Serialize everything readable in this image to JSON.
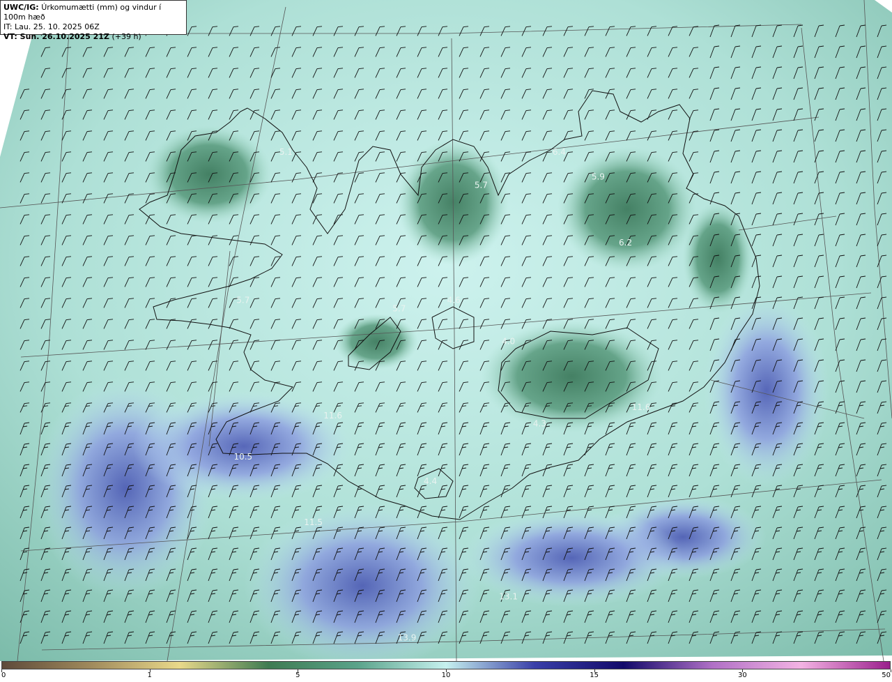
{
  "header": {
    "product": "UWC/IG:",
    "title": "Úrkomumætti (mm) og vindur í 100m hæð",
    "init_time": "IT: Lau. 25. 10. 2025 06Z",
    "valid_prefix": "VT: Sun. 26.10.2025 21Z",
    "valid_offset": "(+39 h)"
  },
  "map_labels": [
    {
      "text": "5.1",
      "lon": -22.9,
      "lat": 65.75
    },
    {
      "text": "5.7",
      "lon": -17.9,
      "lat": 65.55
    },
    {
      "text": "6.4",
      "lon": -15.9,
      "lat": 65.75
    },
    {
      "text": "5.9",
      "lon": -14.9,
      "lat": 65.6
    },
    {
      "text": "6.2",
      "lon": -14.2,
      "lat": 65.2
    },
    {
      "text": "4.6",
      "lon": -18.6,
      "lat": 64.85
    },
    {
      "text": "5.7",
      "lon": -20.0,
      "lat": 64.8
    },
    {
      "text": "4.0",
      "lon": -17.2,
      "lat": 64.6
    },
    {
      "text": "5.7",
      "lon": -24.0,
      "lat": 64.85
    },
    {
      "text": "4.3",
      "lon": -16.4,
      "lat": 64.1
    },
    {
      "text": "4.4",
      "lon": -19.2,
      "lat": 63.75
    },
    {
      "text": "11.6",
      "lon": -21.7,
      "lat": 64.15
    },
    {
      "text": "11.6",
      "lon": -13.8,
      "lat": 64.2
    },
    {
      "text": "11.5",
      "lon": -22.2,
      "lat": 63.5
    },
    {
      "text": "10.5",
      "lon": -24.0,
      "lat": 63.9
    },
    {
      "text": "13.1",
      "lon": -17.2,
      "lat": 63.05
    },
    {
      "text": "13.9",
      "lon": -19.8,
      "lat": 62.8
    }
  ],
  "colorbar": {
    "ticks": [
      "0",
      "1",
      "5",
      "10",
      "15",
      "30",
      "50"
    ],
    "colors": [
      "#5e4a3a",
      "#a08a5c",
      "#e9d98a",
      "#3f7b52",
      "#5aa38a",
      "#c6f1ef",
      "#3a3fa8",
      "#120a6a",
      "#b070c6",
      "#f3b3e3",
      "#9a1f8c"
    ]
  }
}
